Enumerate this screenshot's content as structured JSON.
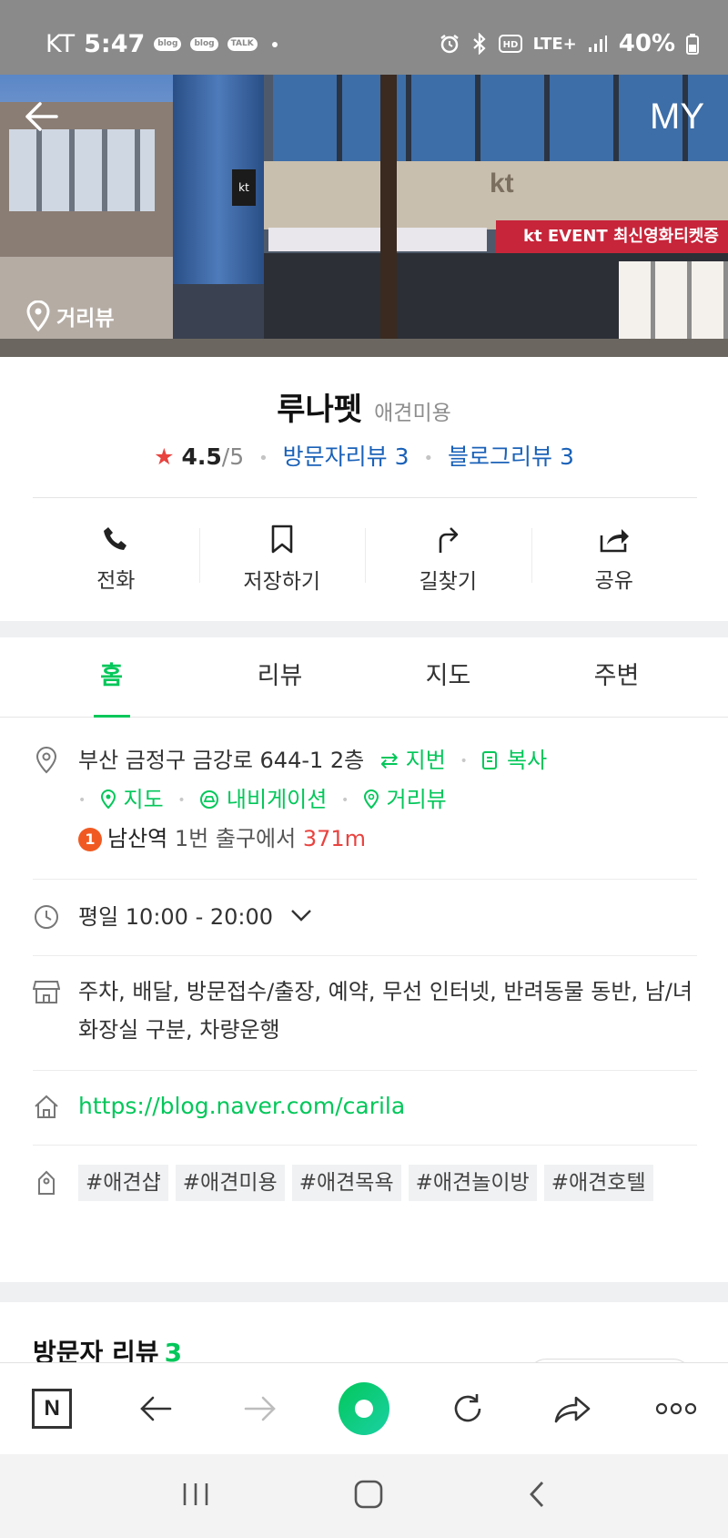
{
  "status_bar": {
    "carrier": "KT",
    "time": "5:47",
    "notifications": [
      "blog",
      "blog",
      "TALK"
    ],
    "network": "LTE+",
    "battery": "40%"
  },
  "hero": {
    "my_label": "MY",
    "street_view_label": "거리뷰",
    "sign_kt": "kt",
    "banner_text": "kt EVENT 최신영화티켓증정"
  },
  "place": {
    "name": "루나펫",
    "category": "애견미용",
    "rating": "4.5",
    "rating_max": "/5",
    "visitor_reviews": "방문자리뷰 3",
    "blog_reviews": "블로그리뷰 3"
  },
  "actions": [
    {
      "label": "전화",
      "icon": "phone-icon"
    },
    {
      "label": "저장하기",
      "icon": "bookmark-icon"
    },
    {
      "label": "길찾기",
      "icon": "directions-icon"
    },
    {
      "label": "공유",
      "icon": "share-icon"
    }
  ],
  "tabs": [
    "홈",
    "리뷰",
    "지도",
    "주변"
  ],
  "address": {
    "text": "부산 금정구 금강로 644-1 2층",
    "lot_label": "지번",
    "copy_label": "복사",
    "map_label": "지도",
    "navi_label": "내비게이션",
    "street_label": "거리뷰",
    "subway_line": "1",
    "station": "남산역",
    "exit_text": "1번 출구에서",
    "distance": "371m"
  },
  "hours": {
    "text": "평일 10:00 - 20:00"
  },
  "amenities": {
    "text": "주차, 배달, 방문접수/출장, 예약, 무선 인터넷, 반려동물 동반, 남/녀 화장실 구분, 차량운행"
  },
  "website": {
    "url": "https://blog.naver.com/carila"
  },
  "tags": [
    "#애견샵",
    "#애견미용",
    "#애견목욕",
    "#애견놀이방",
    "#애견호텔"
  ],
  "reviews": {
    "title": "방문자 리뷰",
    "count": "3"
  },
  "browser": {
    "n_label": "N"
  },
  "colors": {
    "naver_green": "#03c75a",
    "link_blue": "#1a61b8",
    "star_red": "#e8433f",
    "subway_orange": "#f05a22"
  }
}
